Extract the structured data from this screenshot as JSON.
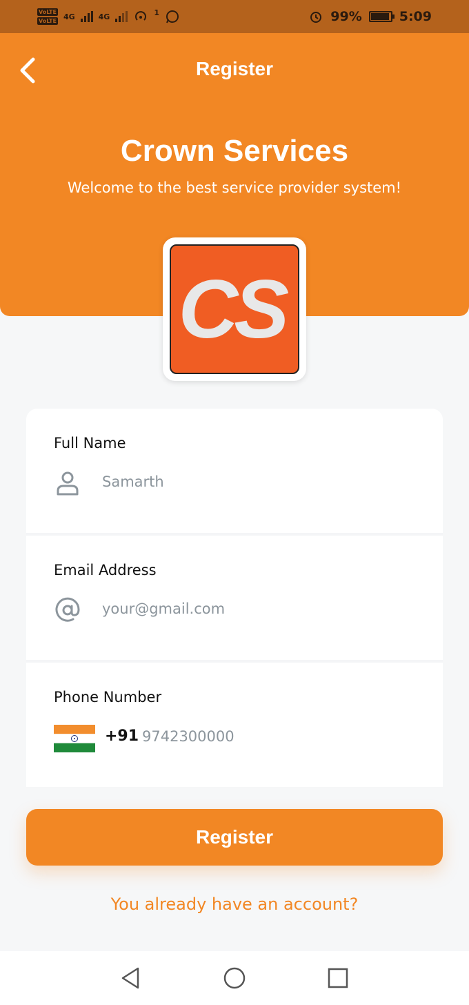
{
  "status_bar": {
    "volte_1": "VoLTE",
    "volte_2": "VoLTE",
    "network_1": "4G",
    "network_2": "4G",
    "hotspot_count": "1",
    "battery_percent": "99%",
    "time": "5:09",
    "icons": [
      "signal-icon",
      "hotspot-icon",
      "whatsapp-icon",
      "alarm-icon",
      "battery-icon"
    ]
  },
  "header": {
    "title": "Register",
    "brand": "Crown Services",
    "tagline": "Welcome to the best service provider system!",
    "background_color": "#f28724"
  },
  "logo": {
    "text": "CS",
    "background_color": "#f05d23"
  },
  "form": {
    "full_name": {
      "label": "Full Name",
      "value": "Samarth",
      "icon": "person-icon"
    },
    "email": {
      "label": "Email Address",
      "placeholder": "your@gmail.com",
      "icon": "at-sign-icon"
    },
    "phone": {
      "label": "Phone Number",
      "country_code": "+91",
      "value": "9742300000",
      "icon": "india-flag-icon"
    }
  },
  "actions": {
    "register_label": "Register",
    "login_link": "You already have an account?"
  },
  "nav_bar": {
    "icons": [
      "back-triangle-icon",
      "home-circle-icon",
      "recents-square-icon"
    ]
  }
}
